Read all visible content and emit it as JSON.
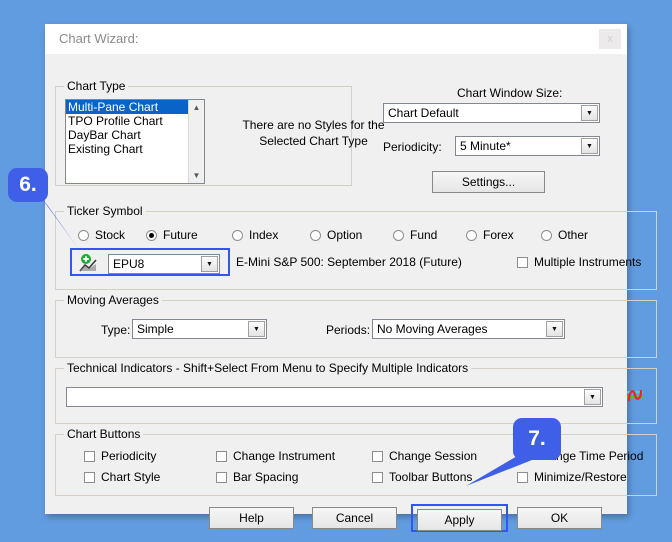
{
  "window": {
    "title": "Chart Wizard:",
    "close_label": "x"
  },
  "chart_type": {
    "group_label": "Chart Type",
    "items": [
      {
        "label": "Multi-Pane Chart",
        "selected": true
      },
      {
        "label": "TPO Profile Chart",
        "selected": false
      },
      {
        "label": "DayBar Chart",
        "selected": false
      },
      {
        "label": "Existing Chart",
        "selected": false
      }
    ],
    "styles_note": "There are no Styles for the Selected Chart Type"
  },
  "chart_window_size": {
    "label": "Chart Window Size:",
    "value": "Chart Default"
  },
  "periodicity": {
    "label": "Periodicity:",
    "value": "5 Minute*"
  },
  "settings_button": {
    "label": "Settings..."
  },
  "ticker_symbol": {
    "group_label": "Ticker Symbol",
    "types": [
      {
        "label": "Stock",
        "selected": false
      },
      {
        "label": "Future",
        "selected": true
      },
      {
        "label": "Index",
        "selected": false
      },
      {
        "label": "Option",
        "selected": false
      },
      {
        "label": "Fund",
        "selected": false
      },
      {
        "label": "Forex",
        "selected": false
      },
      {
        "label": "Other",
        "selected": false
      }
    ],
    "symbol_value": "EPU8",
    "symbol_description": "E-Mini S&P 500: September 2018 (Future)",
    "multiple_instruments": {
      "label": "Multiple Instruments",
      "checked": false
    },
    "icon": "add-chart-icon"
  },
  "moving_averages": {
    "group_label": "Moving Averages",
    "type_label": "Type:",
    "type_value": "Simple",
    "periods_label": "Periods:",
    "periods_value": "No Moving Averages"
  },
  "technical_indicators": {
    "group_label": "Technical Indicators  - Shift+Select From Menu to Specify Multiple Indicators",
    "value": "",
    "icon": "oscillator-icon"
  },
  "chart_buttons": {
    "group_label": "Chart Buttons",
    "items": [
      {
        "label": "Periodicity",
        "checked": false
      },
      {
        "label": "Change Instrument",
        "checked": false
      },
      {
        "label": "Change Session",
        "checked": false
      },
      {
        "label": "Change Time Period",
        "checked": false
      },
      {
        "label": "Chart Style",
        "checked": false
      },
      {
        "label": "Bar Spacing",
        "checked": false
      },
      {
        "label": "Toolbar Buttons",
        "checked": false
      },
      {
        "label": "Minimize/Restore",
        "checked": false
      }
    ]
  },
  "footer_buttons": {
    "help": "Help",
    "cancel": "Cancel",
    "apply": "Apply",
    "ok": "OK"
  },
  "callouts": [
    {
      "label": "6.",
      "target": "ticker-symbol-input"
    },
    {
      "label": "7.",
      "target": "apply-button"
    }
  ],
  "colors": {
    "desktop_background": "#629ce0",
    "dialog_face": "#f0f0f0",
    "selection_blue": "#0a64c8",
    "callout_blue": "#3f5fe8",
    "highlight_border": "#3355f0"
  }
}
